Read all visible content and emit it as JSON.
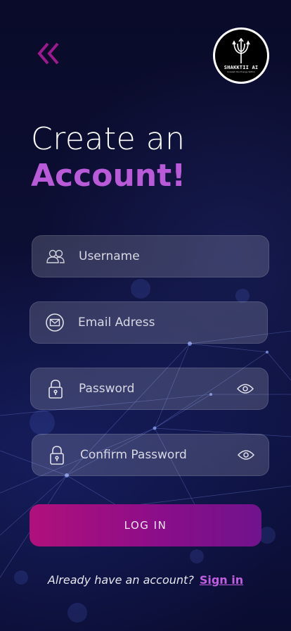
{
  "header": {
    "back_icon": "double-chevron-left-icon",
    "logo": {
      "name": "SHAKKTII AI",
      "tagline": "Unleash the Energy Within"
    }
  },
  "title": {
    "line1": "Create an",
    "line2": "Account!"
  },
  "form": {
    "username": {
      "placeholder": "Username",
      "value": "",
      "icon": "users-icon"
    },
    "email": {
      "placeholder": "Email Adress",
      "value": "",
      "icon": "mail-icon"
    },
    "password": {
      "placeholder": "Password",
      "value": "",
      "icon": "lock-icon",
      "toggle_icon": "eye-icon"
    },
    "confirm_password": {
      "placeholder": "Confirm Password",
      "value": "",
      "icon": "lock-icon",
      "toggle_icon": "eye-icon"
    }
  },
  "login_label": "LOG IN",
  "footer": {
    "question": "Already have an account?",
    "link": "Sign in"
  },
  "colors": {
    "accent": "#b95ad9",
    "button_start": "#b0107c",
    "button_end": "#70138c",
    "background": "#0b0d2e"
  }
}
